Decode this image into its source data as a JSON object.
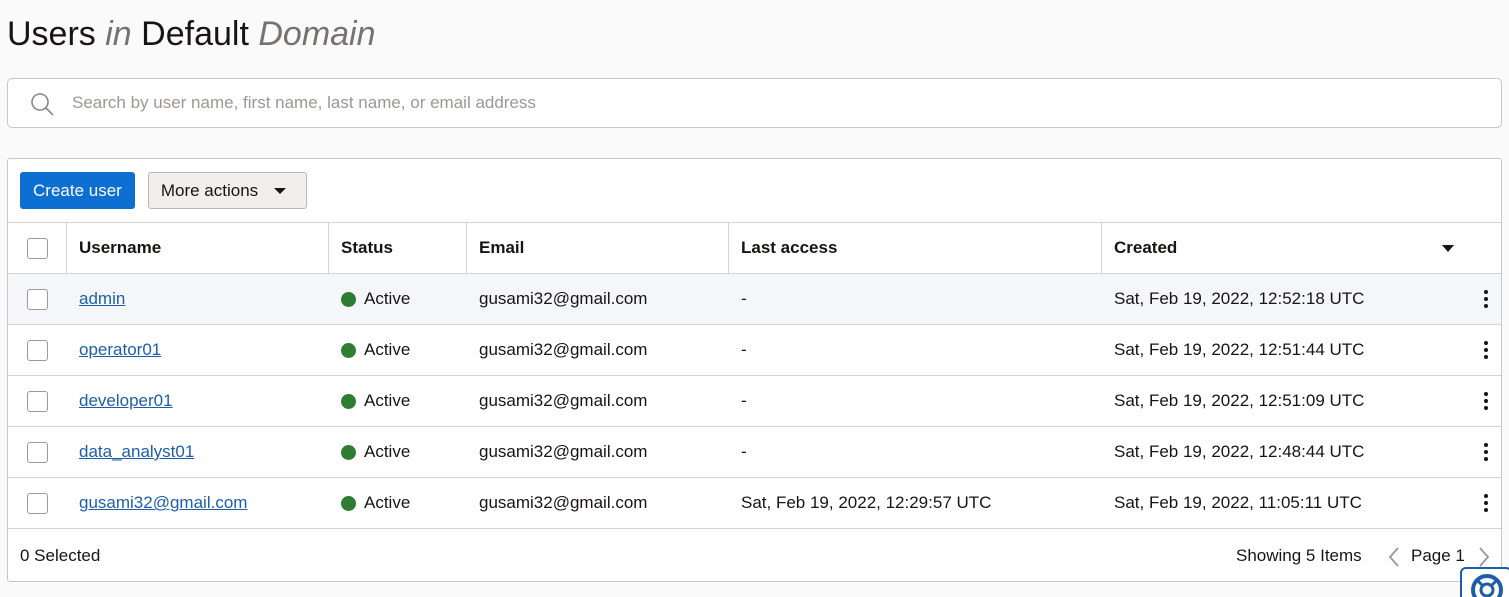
{
  "header": {
    "title_main": "Users",
    "title_in": "in",
    "title_domain": "Default",
    "title_suffix": "Domain"
  },
  "search": {
    "placeholder": "Search by user name, first name, last name, or email address",
    "value": "",
    "icon": "search-icon"
  },
  "toolbar": {
    "create_label": "Create user",
    "more_label": "More actions"
  },
  "table": {
    "columns": {
      "username": "Username",
      "status": "Status",
      "email": "Email",
      "last_access": "Last access",
      "created": "Created"
    },
    "sort_icon": "sort-desc-icon",
    "rows": [
      {
        "username": "admin",
        "status": "Active",
        "email": "gusami32@gmail.com",
        "last_access": "-",
        "created": "Sat, Feb 19, 2022, 12:52:18 UTC"
      },
      {
        "username": "operator01",
        "status": "Active",
        "email": "gusami32@gmail.com",
        "last_access": "-",
        "created": "Sat, Feb 19, 2022, 12:51:44 UTC"
      },
      {
        "username": "developer01",
        "status": "Active",
        "email": "gusami32@gmail.com",
        "last_access": "-",
        "created": "Sat, Feb 19, 2022, 12:51:09 UTC"
      },
      {
        "username": "data_analyst01",
        "status": "Active",
        "email": "gusami32@gmail.com",
        "last_access": "-",
        "created": "Sat, Feb 19, 2022, 12:48:44 UTC"
      },
      {
        "username": "gusami32@gmail.com",
        "status": "Active",
        "email": "gusami32@gmail.com",
        "last_access": "Sat, Feb 19, 2022, 12:29:57 UTC",
        "created": "Sat, Feb 19, 2022, 11:05:11 UTC"
      }
    ],
    "status_color": "#2e7d32"
  },
  "footer": {
    "selected": "0 Selected",
    "showing": "Showing 5 Items",
    "page": "Page 1"
  },
  "colors": {
    "accent": "#0c6fd1",
    "link": "#1e5ea8"
  }
}
